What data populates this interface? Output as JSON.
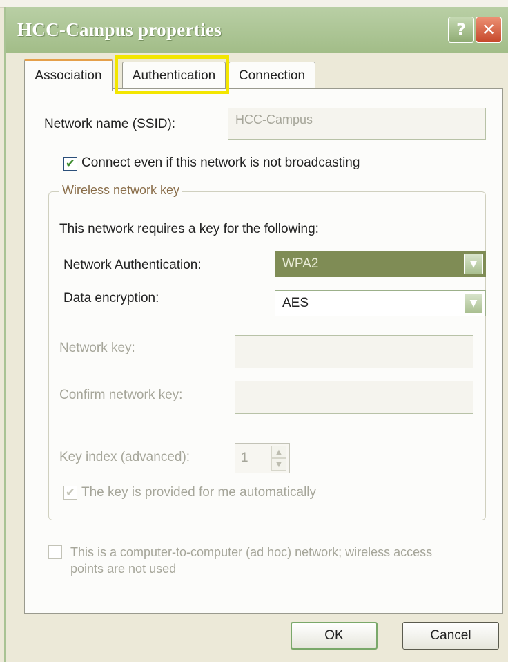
{
  "window": {
    "title": "HCC-Campus properties"
  },
  "titlebar": {
    "help_label": "?",
    "close_label": "✕"
  },
  "tabs": [
    {
      "label": "Association",
      "selected": true
    },
    {
      "label": "Authentication",
      "highlighted": true
    },
    {
      "label": "Connection"
    }
  ],
  "association": {
    "ssid_label": "Network name (SSID):",
    "ssid_value": "HCC-Campus",
    "broadcast_checkbox": {
      "label": "Connect even if this network is not broadcasting",
      "checked": true,
      "mark": "✔"
    },
    "wireless_key": {
      "group_title": "Wireless network key",
      "intro": "This network requires a key for the following:",
      "auth_label": "Network Authentication:",
      "auth_value": "WPA2",
      "encryption_label": "Data encryption:",
      "encryption_value": "AES",
      "network_key_label": "Network key:",
      "confirm_key_label": "Confirm network key:",
      "key_index_label": "Key index (advanced):",
      "key_index_value": "1",
      "auto_key_checkbox": {
        "label": "The key is provided for me automatically",
        "checked": true,
        "enabled": false,
        "mark": "✔"
      }
    },
    "adhoc_checkbox": {
      "label": "This is a computer-to-computer (ad hoc) network; wireless access points are not used",
      "checked": false,
      "enabled": false
    }
  },
  "buttons": {
    "ok": "OK",
    "cancel": "Cancel"
  },
  "icons": {
    "dropdown_arrow": "▼",
    "spin_up": "▲",
    "spin_down": "▼"
  },
  "colors": {
    "titlebar": "#a8c28f",
    "close_button": "#d6583a",
    "highlight": "#f3e600",
    "selected_dropdown": "#7f8c55"
  }
}
